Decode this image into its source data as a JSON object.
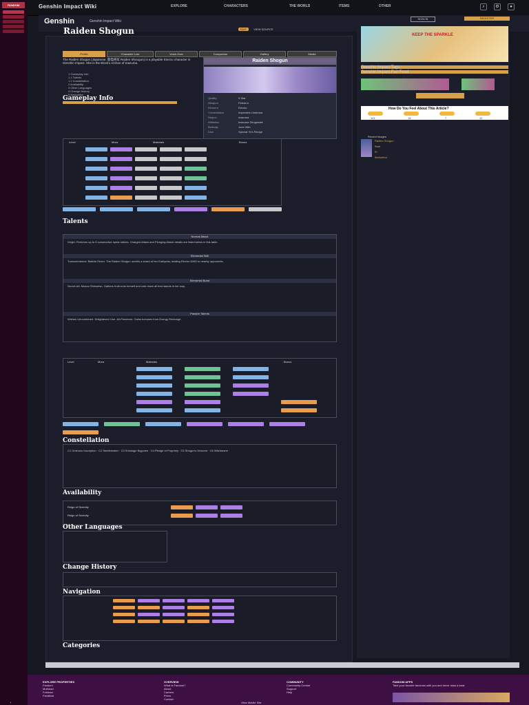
{
  "rail": {
    "logo": "FANDOM"
  },
  "topbar": {
    "wiki_title": "Genshin Impact Wiki",
    "nav": [
      "EXPLORE",
      "CHARACTERS",
      "THE WORLD",
      "ITEMS",
      "OTHER"
    ]
  },
  "header": {
    "site": "Genshin",
    "subtitle": "Genshin Impact Wiki",
    "signin": "SIGN IN",
    "register": "REGISTER"
  },
  "article": {
    "title": "Raiden Shogun",
    "tools": [
      "EDIT",
      "VIEW SOURCE"
    ],
    "tabs": [
      "Profile",
      "Character Lore",
      "Voice-Over",
      "Companion",
      "Gallery",
      "Media"
    ],
    "intro": "The Raiden Shogun (Japanese: 雷电将军 Raiden Shougun) is a playable Electro character in Genshin Impact. She is the Electro Archon of Inazuma.",
    "toc": [
      "1 Gameplay Info",
      "1.1 Talents",
      "1.2 Constellation",
      "2 Availability",
      "3 Other Languages",
      "4 Change History",
      "5 Navigation"
    ],
    "gameplay": "Gameplay Info",
    "talents": "Talents",
    "constellation": "Constellation",
    "availability": "Availability",
    "languages": "Other Languages",
    "history": "Change History",
    "navigation": "Navigation",
    "categories": "Categories",
    "infobox": {
      "name": "Raiden Shogun",
      "rows": [
        [
          "Quality",
          "5 Star"
        ],
        [
          "Weapon",
          "Polearm"
        ],
        [
          "Element",
          "Electro"
        ],
        [
          "Constellation",
          "Imperatrix Umbrosa"
        ],
        [
          "Region",
          "Inazuma"
        ],
        [
          "Affiliation",
          "Inazuma Shogunate"
        ],
        [
          "Birthday",
          "June 26th"
        ],
        [
          "Dish",
          "Special: Ei's Recipe"
        ]
      ]
    }
  },
  "sidebar": {
    "ad_text": "KEEP THE SPARKLE",
    "bar1": "Genshin Impact Tags",
    "bar2": "Genshin Impact Fan Feed",
    "poll_question": "How Do You Feel About This Article?",
    "poll_counts": [
      "101",
      "18",
      "7",
      "12"
    ],
    "recent_title": "Recent Images",
    "recent_links": [
      "Raiden Shogun",
      "Baal",
      "Ei",
      "Beelzebul"
    ]
  },
  "footer": {
    "col1_heading": "EXPLORE PROPERTIES",
    "col1": [
      "Fandom",
      "Muthead",
      "Futhead",
      "Fanatical"
    ],
    "col2_heading": "OVERVIEW",
    "col2": [
      "What is Fandom?",
      "About",
      "Careers",
      "Press",
      "Contact"
    ],
    "col3_heading": "COMMUNITY",
    "col3": [
      "Community Central",
      "Support",
      "Help"
    ],
    "col4_heading": "FANDOM APPS",
    "col4": [
      "Take your favorite fandoms with you and never miss a beat."
    ],
    "bottom": "View Mobile Site"
  }
}
